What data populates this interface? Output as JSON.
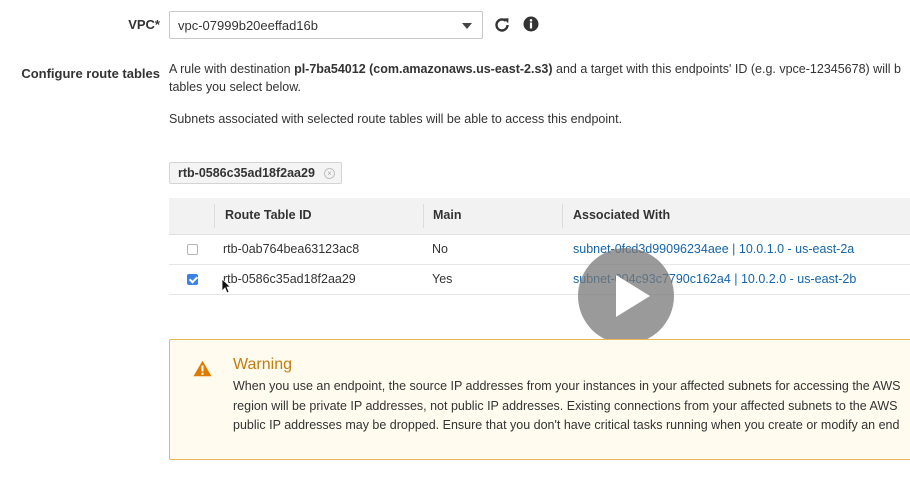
{
  "vpc": {
    "label": "VPC*",
    "value": "vpc-07999b20eeffad16b"
  },
  "route_tables": {
    "label": "Configure route tables",
    "desc_prefix": "A rule with destination ",
    "desc_bold": "pl-7ba54012 (com.amazonaws.us-east-2.s3)",
    "desc_suffix": " and a target with this endpoints' ID (e.g. vpce-12345678) will b",
    "desc_line2": "tables you select below.",
    "subnets_note": "Subnets associated with selected route tables will be able to access this endpoint.",
    "selected_chip": "rtb-0586c35ad18f2aa29",
    "columns": [
      "Route Table ID",
      "Main",
      "Associated With"
    ],
    "rows": [
      {
        "id": "rtb-0ab764bea63123ac8",
        "main": "No",
        "associated": "subnet-0fcd3d99096234aee | 10.0.1.0 - us-east-2a",
        "checked": false
      },
      {
        "id": "rtb-0586c35ad18f2aa29",
        "main": "Yes",
        "associated": "subnet-004c93c7790c162a4 | 10.0.2.0 - us-east-2b",
        "checked": true
      }
    ]
  },
  "warning": {
    "title": "Warning",
    "line1": "When you use an endpoint, the source IP addresses from your instances in your affected subnets for accessing the AWS",
    "line2": "region will be private IP addresses, not public IP addresses. Existing connections from your affected subnets to the AWS",
    "line3": "public IP addresses may be dropped. Ensure that you don't have critical tasks running when you create or modify an end"
  },
  "colors": {
    "link": "#1565a8",
    "warning_border": "#f0b357",
    "warning_title": "#c27c0e",
    "checkbox_checked": "#3b82e6"
  },
  "icons": [
    "caret-down-icon",
    "refresh-icon",
    "info-icon",
    "clear-chip-icon",
    "warning-icon",
    "play-icon",
    "mouse-cursor-icon"
  ]
}
